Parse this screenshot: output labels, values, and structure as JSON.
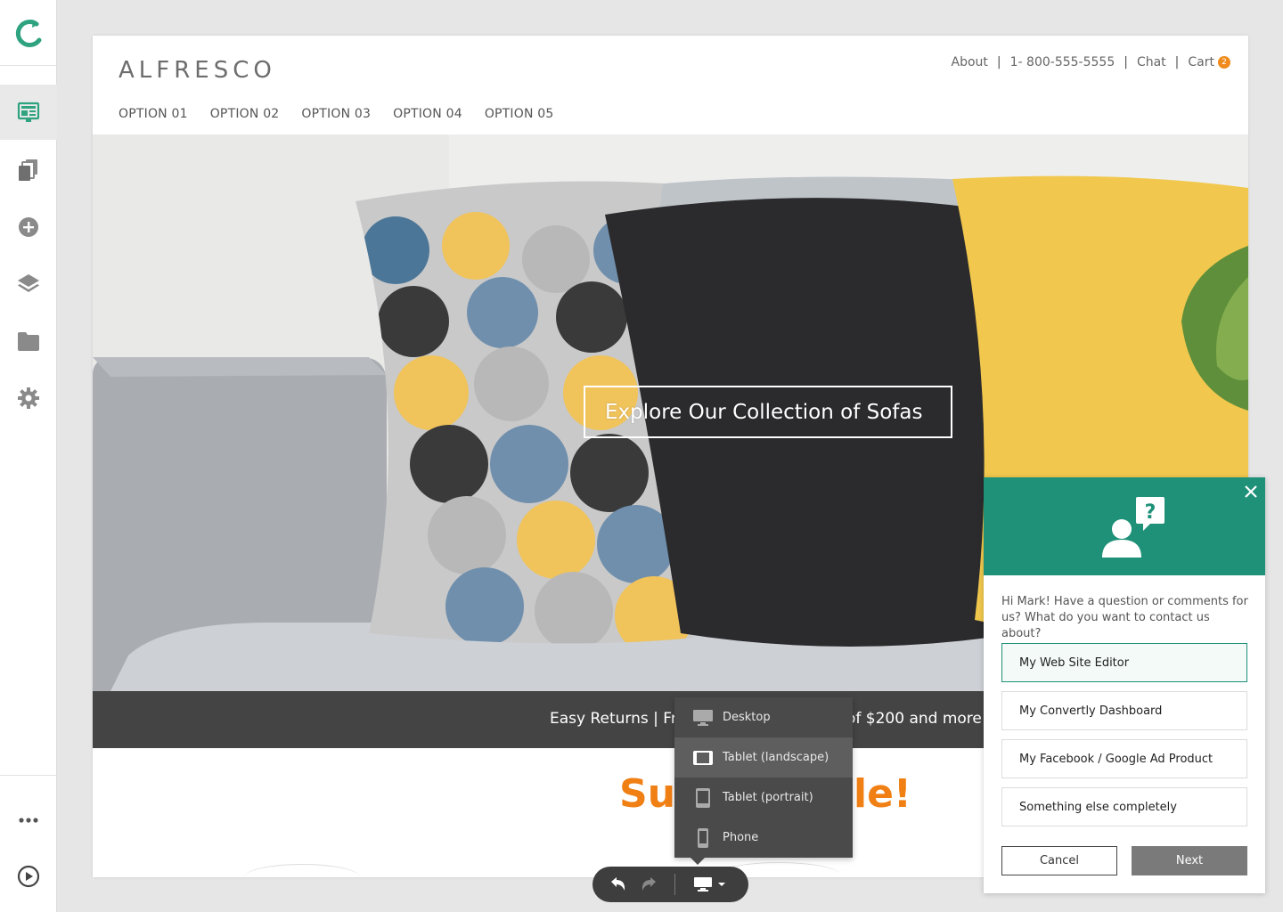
{
  "sidebar": {
    "items": [
      {
        "icon": "page-editor-icon",
        "active": true
      },
      {
        "icon": "pages-icon"
      },
      {
        "icon": "add-icon"
      },
      {
        "icon": "layers-icon"
      },
      {
        "icon": "folder-icon"
      },
      {
        "icon": "settings-icon"
      }
    ],
    "bottom": [
      {
        "icon": "more-icon"
      },
      {
        "icon": "preview-play-icon"
      }
    ],
    "accent": "#2fa37f"
  },
  "site": {
    "logo": "ALFRESCO",
    "top_links": {
      "about": "About",
      "phone": "1- 800-555-5555",
      "chat": "Chat",
      "cart": "Cart",
      "cart_count": "2",
      "separator": "|"
    },
    "nav": [
      "OPTION 01",
      "OPTION 02",
      "OPTION 03",
      "OPTION 04",
      "OPTION 05"
    ],
    "hero_cta": "Explore Our Collection of  Sofas",
    "promo_left": "Easy Returns  |  Fr",
    "promo_right": "of $200 and more",
    "sale_left": "Su",
    "sale_right": "le!",
    "accent": "#f07f14"
  },
  "device_menu": {
    "items": [
      {
        "label": "Desktop",
        "icon": "desktop-icon"
      },
      {
        "label": "Tablet (landscape)",
        "icon": "tablet-landscape-icon",
        "selected": true
      },
      {
        "label": "Tablet (portrait)",
        "icon": "tablet-portrait-icon"
      },
      {
        "label": "Phone",
        "icon": "phone-icon"
      }
    ]
  },
  "toolbar": {
    "undo": "undo-icon",
    "redo": "redo-icon",
    "device": "desktop-icon"
  },
  "contact_widget": {
    "header_color": "#1e9178",
    "message": "Hi Mark! Have a question or comments for us? What do you want to contact us about?",
    "options": [
      {
        "label": "My Web Site Editor",
        "selected": true
      },
      {
        "label": "My Convertly Dashboard"
      },
      {
        "label": "My Facebook / Google Ad Product"
      },
      {
        "label": "Something else completely"
      }
    ],
    "cancel": "Cancel",
    "next": "Next"
  }
}
